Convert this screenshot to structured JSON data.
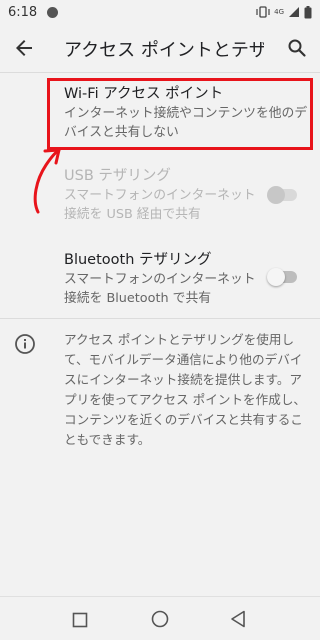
{
  "status_bar": {
    "time": "6:18",
    "network": "4G"
  },
  "app_bar": {
    "title": "アクセス ポイントとテザリング"
  },
  "items": [
    {
      "title": "Wi-Fi アクセス ポイント",
      "subtitle": "インターネット接続やコンテンツを他のデバイスと共有しない"
    },
    {
      "title": "USB テザリング",
      "subtitle": "スマートフォンのインターネット接続を USB 経由で共有",
      "enabled": false,
      "checked": false
    },
    {
      "title": "Bluetooth テザリング",
      "subtitle": "スマートフォンのインターネット接続を Bluetooth で共有",
      "enabled": true,
      "checked": false
    }
  ],
  "info": {
    "text": "アクセス ポイントとテザリングを使用して、モバイルデータ通信により他のデバイスにインターネット接続を提供します。アプリを使ってアクセス ポイントを作成し、コンテンツを近くのデバイスと共有することもできます。"
  },
  "colors": {
    "highlight": "#e8141b",
    "background": "#f2f2f2"
  }
}
